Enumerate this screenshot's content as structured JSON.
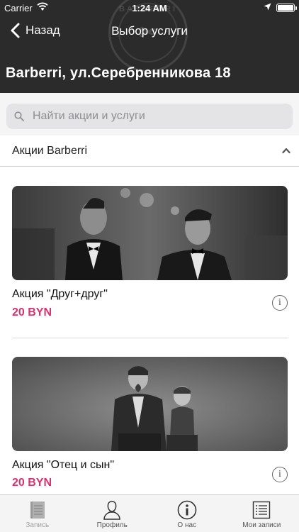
{
  "status_bar": {
    "carrier": "Carrier",
    "time": "1:24 AM"
  },
  "nav": {
    "back_label": "Назад",
    "title": "Выбор услуги"
  },
  "salon": {
    "name": "Barberri, ул.Серебренникова 18"
  },
  "search": {
    "placeholder": "Найти акции и услуги"
  },
  "section": {
    "title": "Акции Barberri",
    "expanded": true
  },
  "promotions": [
    {
      "title": "Акция \"Друг+друг\"",
      "price": "20 BYN",
      "image": "two-men-in-tuxedos-photo"
    },
    {
      "title": "Акция \"Отец и сын\"",
      "price": "20 BYN",
      "image": "father-and-son-photo"
    }
  ],
  "tabs": [
    {
      "label": "Запись",
      "icon": "document-icon",
      "active": false
    },
    {
      "label": "Профиль",
      "icon": "profile-icon",
      "active": true
    },
    {
      "label": "О нас",
      "icon": "info-icon",
      "active": true
    },
    {
      "label": "Мои записи",
      "icon": "list-icon",
      "active": true
    }
  ],
  "colors": {
    "header_bg": "#2b2b2b",
    "price": "#d6336c",
    "search_bg": "#e4e4e6"
  },
  "watermark_logo": {
    "text": "BARBERRI"
  }
}
